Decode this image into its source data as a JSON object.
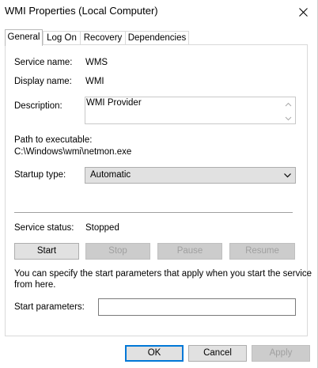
{
  "window": {
    "title": "WMI Properties (Local Computer)"
  },
  "tabs": [
    {
      "label": "General",
      "active": true
    },
    {
      "label": "Log On",
      "active": false
    },
    {
      "label": "Recovery",
      "active": false
    },
    {
      "label": "Dependencies",
      "active": false
    }
  ],
  "general": {
    "service_name_label": "Service name:",
    "service_name_value": "WMS",
    "display_name_label": "Display name:",
    "display_name_value": "WMI",
    "description_label": "Description:",
    "description_value": "WMI Provider",
    "path_label": "Path to executable:",
    "path_value": "C:\\Windows\\wmi\\netmon.exe",
    "startup_type_label": "Startup type:",
    "startup_type_value": "Automatic",
    "service_status_label": "Service status:",
    "service_status_value": "Stopped",
    "buttons": {
      "start": "Start",
      "stop": "Stop",
      "pause": "Pause",
      "resume": "Resume"
    },
    "info_text_line1": "You can specify the start parameters that apply when you start the service",
    "info_text_line2": "from here.",
    "start_params_label": "Start parameters:",
    "start_params_value": ""
  },
  "footer": {
    "ok": "OK",
    "cancel": "Cancel",
    "apply": "Apply"
  }
}
